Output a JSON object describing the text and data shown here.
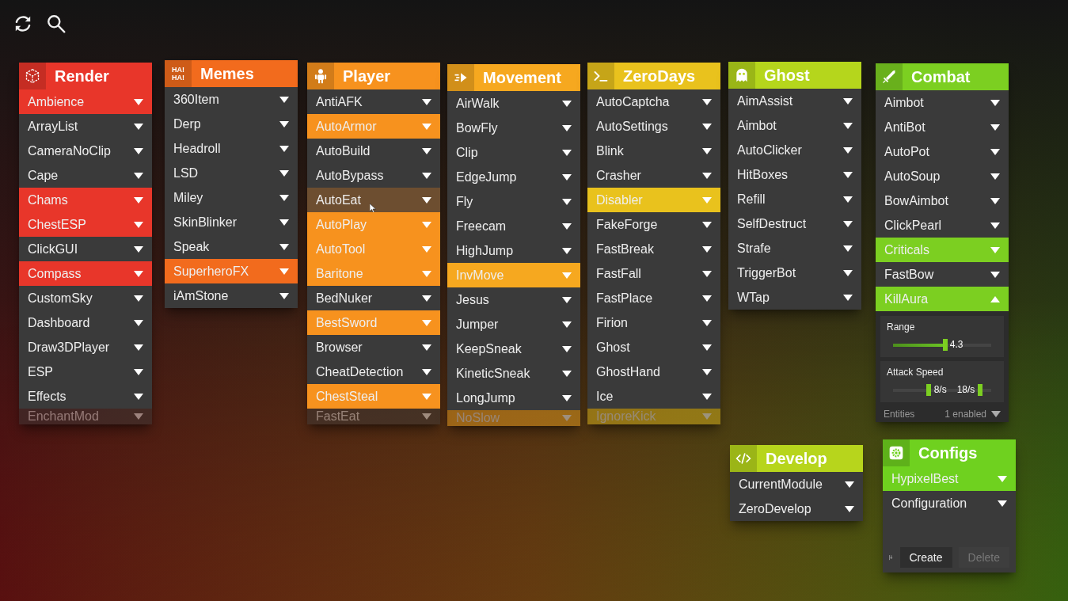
{
  "toolbar": {
    "buttons": [
      {
        "kind": "refresh"
      },
      {
        "kind": "search"
      }
    ]
  },
  "panels": [
    {
      "title": "Render",
      "color": "#e8362a",
      "items": [
        {
          "label": "Ambience",
          "enabled": true
        },
        {
          "label": "ArrayList",
          "enabled": false
        },
        {
          "label": "CameraNoClip",
          "enabled": false
        },
        {
          "label": "Cape",
          "enabled": false
        },
        {
          "label": "Chams",
          "enabled": true
        },
        {
          "label": "ChestESP",
          "enabled": true
        },
        {
          "label": "ClickGUI",
          "enabled": false
        },
        {
          "label": "Compass",
          "enabled": true
        },
        {
          "label": "CustomSky",
          "enabled": false
        },
        {
          "label": "Dashboard",
          "enabled": false
        },
        {
          "label": "Draw3DPlayer",
          "enabled": false
        },
        {
          "label": "ESP",
          "enabled": false
        },
        {
          "label": "Effects",
          "enabled": false
        },
        {
          "label": "EnchantMod",
          "enabled": false,
          "cut_off": true
        }
      ]
    },
    {
      "title": "Memes",
      "color": "#f26b1d",
      "icon_text": "HA!\nHA!",
      "items": [
        {
          "label": "360Item",
          "enabled": false
        },
        {
          "label": "Derp",
          "enabled": false
        },
        {
          "label": "Headroll",
          "enabled": false
        },
        {
          "label": "LSD",
          "enabled": false
        },
        {
          "label": "Miley",
          "enabled": false
        },
        {
          "label": "SkinBlinker",
          "enabled": false
        },
        {
          "label": "Speak",
          "enabled": false
        },
        {
          "label": "SuperheroFX",
          "enabled": true
        },
        {
          "label": "iAmStone",
          "enabled": false
        }
      ]
    },
    {
      "title": "Player",
      "color": "#f7921e",
      "items": [
        {
          "label": "AntiAFK",
          "enabled": false
        },
        {
          "label": "AutoArmor",
          "enabled": true
        },
        {
          "label": "AutoBuild",
          "enabled": false
        },
        {
          "label": "AutoBypass",
          "enabled": false
        },
        {
          "label": "AutoEat",
          "enabled": false,
          "hovered": true
        },
        {
          "label": "AutoPlay",
          "enabled": true
        },
        {
          "label": "AutoTool",
          "enabled": true
        },
        {
          "label": "Baritone",
          "enabled": true
        },
        {
          "label": "BedNuker",
          "enabled": false
        },
        {
          "label": "BestSword",
          "enabled": true
        },
        {
          "label": "Browser",
          "enabled": false
        },
        {
          "label": "CheatDetection",
          "enabled": false
        },
        {
          "label": "ChestSteal",
          "enabled": true
        },
        {
          "label": "FastEat",
          "enabled": false,
          "cut_off": true
        }
      ]
    },
    {
      "title": "Movement",
      "color": "#f6a81f",
      "items": [
        {
          "label": "AirWalk",
          "enabled": false
        },
        {
          "label": "BowFly",
          "enabled": false
        },
        {
          "label": "Clip",
          "enabled": false
        },
        {
          "label": "EdgeJump",
          "enabled": false
        },
        {
          "label": "Fly",
          "enabled": false
        },
        {
          "label": "Freecam",
          "enabled": false
        },
        {
          "label": "HighJump",
          "enabled": false
        },
        {
          "label": "InvMove",
          "enabled": true
        },
        {
          "label": "Jesus",
          "enabled": false
        },
        {
          "label": "Jumper",
          "enabled": false
        },
        {
          "label": "KeepSneak",
          "enabled": false
        },
        {
          "label": "KineticSneak",
          "enabled": false
        },
        {
          "label": "LongJump",
          "enabled": false
        },
        {
          "label": "NoSlow",
          "enabled": true,
          "cut_off": true
        }
      ]
    },
    {
      "title": "ZeroDays",
      "color": "#e9c21d",
      "items": [
        {
          "label": "AutoCaptcha",
          "enabled": false
        },
        {
          "label": "AutoSettings",
          "enabled": false
        },
        {
          "label": "Blink",
          "enabled": false
        },
        {
          "label": "Crasher",
          "enabled": false
        },
        {
          "label": "Disabler",
          "enabled": true
        },
        {
          "label": "FakeForge",
          "enabled": false
        },
        {
          "label": "FastBreak",
          "enabled": false
        },
        {
          "label": "FastFall",
          "enabled": false
        },
        {
          "label": "FastPlace",
          "enabled": false
        },
        {
          "label": "Firion",
          "enabled": false
        },
        {
          "label": "Ghost",
          "enabled": false
        },
        {
          "label": "GhostHand",
          "enabled": false
        },
        {
          "label": "Ice",
          "enabled": false
        },
        {
          "label": "IgnoreKick",
          "enabled": true,
          "cut_off": true
        }
      ]
    },
    {
      "title": "Ghost",
      "color": "#b5d61c",
      "items": [
        {
          "label": "AimAssist",
          "enabled": false
        },
        {
          "label": "Aimbot",
          "enabled": false
        },
        {
          "label": "AutoClicker",
          "enabled": false
        },
        {
          "label": "HitBoxes",
          "enabled": false
        },
        {
          "label": "Refill",
          "enabled": false
        },
        {
          "label": "SelfDestruct",
          "enabled": false
        },
        {
          "label": "Strafe",
          "enabled": false
        },
        {
          "label": "TriggerBot",
          "enabled": false
        },
        {
          "label": "WTap",
          "enabled": false
        }
      ]
    },
    {
      "title": "Combat",
      "color": "#7ccf21",
      "items": [
        {
          "label": "Aimbot",
          "enabled": false
        },
        {
          "label": "AntiBot",
          "enabled": false
        },
        {
          "label": "AutoPot",
          "enabled": false
        },
        {
          "label": "AutoSoup",
          "enabled": false
        },
        {
          "label": "BowAimbot",
          "enabled": false
        },
        {
          "label": "ClickPearl",
          "enabled": false
        },
        {
          "label": "Criticals",
          "enabled": true
        },
        {
          "label": "FastBow",
          "enabled": false
        },
        {
          "label": "KillAura",
          "enabled": true,
          "expanded": true,
          "settings": [
            {
              "kind": "slider",
              "label": "Range",
              "level": 0.53,
              "reading": "4.3"
            },
            {
              "kind": "range",
              "label": "Attack Speed",
              "thumbs": [
                {
                  "level": 0.36,
                  "reading": "8/s"
                },
                {
                  "level": 0.89,
                  "reading": "18/s"
                }
              ]
            },
            {
              "kind": "select",
              "label": "Entities",
              "value": "1 enabled"
            }
          ]
        }
      ]
    }
  ],
  "develop": {
    "title": "Develop",
    "color": "#b7d51c",
    "items": [
      {
        "label": "CurrentModule",
        "enabled": false
      },
      {
        "label": "ZeroDevelop",
        "enabled": false
      }
    ]
  },
  "configs": {
    "title": "Configs",
    "color": "#6fd11f",
    "items": [
      {
        "label": "HypixelBest",
        "enabled": true
      },
      {
        "label": "Configuration",
        "enabled": false
      }
    ],
    "buttons": [
      {
        "label": "Create",
        "disabled": false
      },
      {
        "label": "Delete",
        "disabled": true
      }
    ]
  }
}
